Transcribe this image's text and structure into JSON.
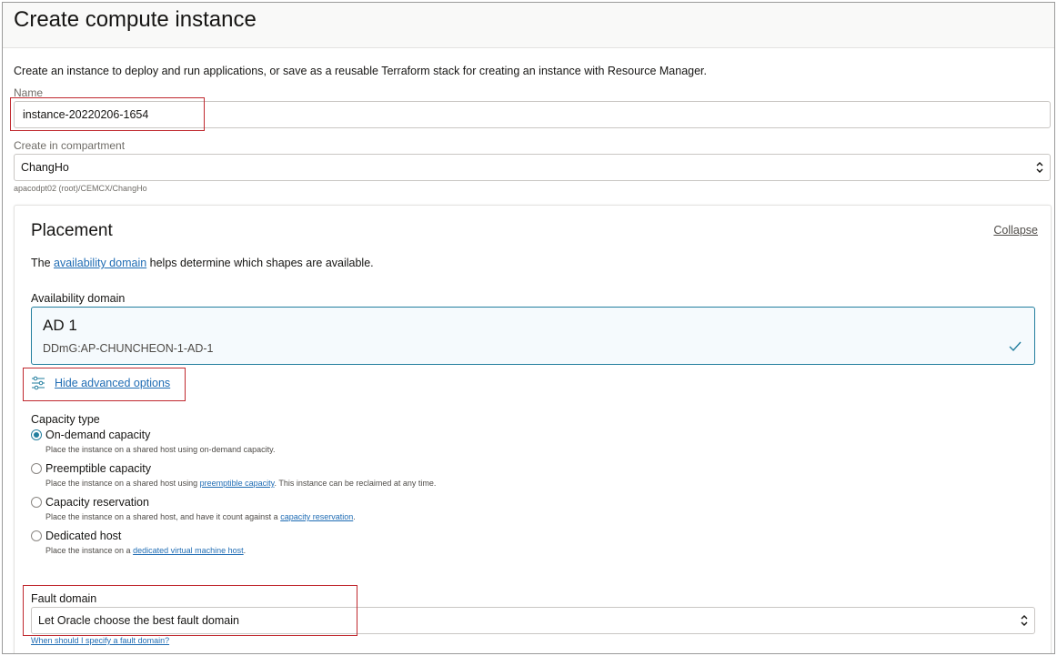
{
  "page": {
    "title": "Create compute instance",
    "description": "Create an instance to deploy and run applications, or save as a reusable Terraform stack for creating an instance with Resource Manager."
  },
  "name_field": {
    "label": "Name",
    "value": "instance-20220206-1654"
  },
  "compartment": {
    "label": "Create in compartment",
    "value": "ChangHo",
    "path": "apacodpt02 (root)/CEMCX/ChangHo"
  },
  "placement": {
    "title": "Placement",
    "collapse_label": "Collapse",
    "desc_prefix": "The",
    "desc_link": "availability domain",
    "desc_suffix": "helps determine which shapes are available.",
    "ad_label": "Availability domain",
    "ad_name": "AD 1",
    "ad_id": "DDmG:AP-CHUNCHEON-1-AD-1",
    "advanced_label": "Hide advanced options",
    "capacity_label": "Capacity type",
    "capacity_options": [
      {
        "label": "On-demand capacity",
        "selected": true,
        "hint_prefix": "Place the instance on a shared host using on-demand capacity.",
        "hint_link": "",
        "hint_suffix": ""
      },
      {
        "label": "Preemptible capacity",
        "selected": false,
        "hint_prefix": "Place the instance on a shared host using",
        "hint_link": "preemptible capacity",
        "hint_suffix": ". This instance can be reclaimed at any time."
      },
      {
        "label": "Capacity reservation",
        "selected": false,
        "hint_prefix": "Place the instance on a shared host, and have it count against a",
        "hint_link": "capacity reservation",
        "hint_suffix": "."
      },
      {
        "label": "Dedicated host",
        "selected": false,
        "hint_prefix": "Place the instance on a",
        "hint_link": "dedicated virtual machine host",
        "hint_suffix": "."
      }
    ],
    "fault_label": "Fault domain",
    "fault_value": "Let Oracle choose the best fault domain",
    "fault_help": "When should I specify a fault domain?"
  },
  "colors": {
    "accent": "#227e9e",
    "link": "#1f6cb4",
    "highlight_box": "#c0282e"
  }
}
